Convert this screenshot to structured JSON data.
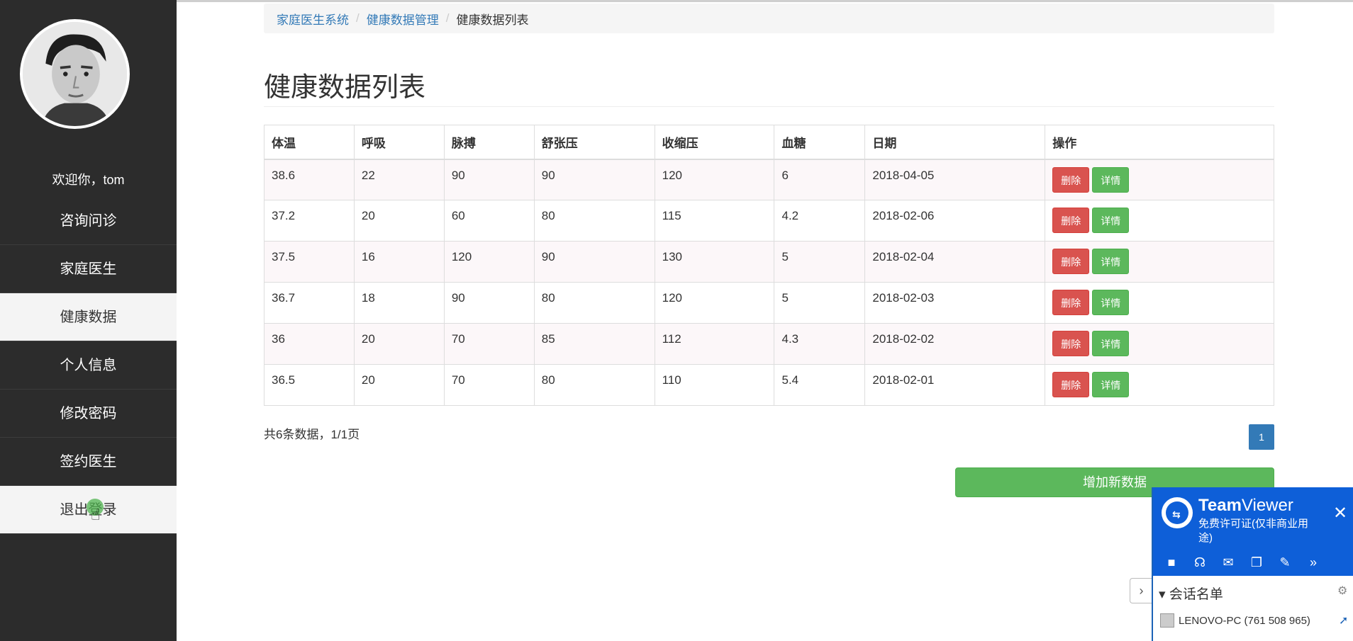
{
  "sidebar": {
    "welcome": "欢迎你，tom",
    "items": [
      {
        "label": "咨询问诊"
      },
      {
        "label": "家庭医生"
      },
      {
        "label": "健康数据"
      },
      {
        "label": "个人信息"
      },
      {
        "label": "修改密码"
      },
      {
        "label": "签约医生"
      },
      {
        "label": "退出登录"
      }
    ]
  },
  "breadcrumb": {
    "items": [
      "家庭医生系统",
      "健康数据管理"
    ],
    "current": "健康数据列表",
    "separator": "/"
  },
  "page": {
    "title": "健康数据列表"
  },
  "table": {
    "headers": [
      "体温",
      "呼吸",
      "脉搏",
      "舒张压",
      "收缩压",
      "血糖",
      "日期",
      "操作"
    ],
    "rows": [
      [
        "38.6",
        "22",
        "90",
        "90",
        "120",
        "6",
        "2018-04-05"
      ],
      [
        "37.2",
        "20",
        "60",
        "80",
        "115",
        "4.2",
        "2018-02-06"
      ],
      [
        "37.5",
        "16",
        "120",
        "90",
        "130",
        "5",
        "2018-02-04"
      ],
      [
        "36.7",
        "18",
        "90",
        "80",
        "120",
        "5",
        "2018-02-03"
      ],
      [
        "36",
        "20",
        "70",
        "85",
        "112",
        "4.3",
        "2018-02-02"
      ],
      [
        "36.5",
        "20",
        "70",
        "80",
        "110",
        "5.4",
        "2018-02-01"
      ]
    ],
    "delete_label": "删除",
    "detail_label": "详情"
  },
  "pagination": {
    "summary": "共6条数据，1/1页",
    "current_page": "1"
  },
  "add_button": "增加新数据",
  "teamviewer": {
    "name_bold": "Team",
    "name_rest": "Viewer",
    "license": "免费许可证(仅非商业用途)",
    "close": "✕",
    "session_list": "会话名单",
    "computer": "LENOVO-PC (761 508 965)",
    "tab_arrow": "›"
  },
  "colors": {
    "sidebar_bg": "#2c2c2c",
    "link": "#337ab7",
    "danger": "#d9534f",
    "success": "#5cb85c",
    "teamviewer_blue": "#0e5fd8"
  }
}
